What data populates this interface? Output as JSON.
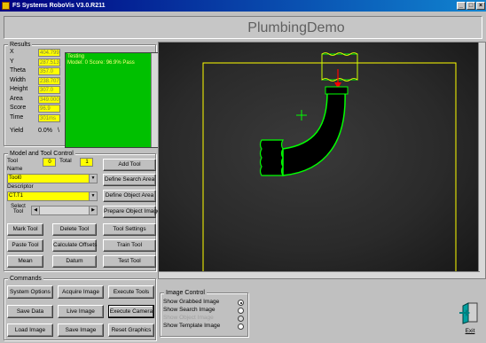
{
  "window": {
    "title": "FS Systems RoboVis V3.0.R211",
    "controls": [
      "_",
      "□",
      "×"
    ]
  },
  "banner": {
    "title": "PlumbingDemo"
  },
  "results": {
    "group_label": "Results",
    "fields": [
      {
        "label": "X",
        "value": "404.799"
      },
      {
        "label": "Y",
        "value": "287.513"
      },
      {
        "label": "Theta",
        "value": "357.0"
      },
      {
        "label": "Width",
        "value": "238.707"
      },
      {
        "label": "Height",
        "value": "307.0"
      },
      {
        "label": "Area",
        "value": "349.000"
      },
      {
        "label": "Score",
        "value": "96.9"
      },
      {
        "label": "Time",
        "value": "301ms"
      }
    ],
    "yield_label": "Yield",
    "yield_value": "0.0%",
    "yield_spinner": "\\",
    "log_lines": [
      "Testing",
      "Model: 0 Score: 96.9% Pass"
    ]
  },
  "model_tool": {
    "group_label": "Model and Tool Control",
    "tool_label": "Tool",
    "tool_value": "0",
    "total_label": "Total",
    "total_value": "1",
    "add_tool": "Add Tool",
    "name_label": "Name",
    "name_value": "Tool0",
    "define_search": "Define Search Area",
    "descriptor_label": "Descriptor",
    "descriptor_value": "CT.T1",
    "define_object": "Define Object Area",
    "select_tool_label": "Select Tool",
    "prepare_image": "Prepare Object Image",
    "mark_tool": "Mark Tool",
    "delete_tool": "Delete Tool",
    "tool_settings": "Tool Settings",
    "paste_tool": "Paste Tool",
    "calculate_offsets": "Calculate Offsets",
    "train_tool": "Train Tool",
    "mean": "Mean",
    "datum": "Datum",
    "test_tool": "Test Tool"
  },
  "commands": {
    "group_label": "Commands",
    "system_options": "System Options",
    "acquire_image": "Acquire Image",
    "execute_tools": "Execute Tools",
    "save_data": "Save Data",
    "live_image": "Live Image",
    "execute_camera": "Execute Camera",
    "load_image": "Load Image",
    "save_image": "Save Image",
    "reset_graphics": "Reset Graphics"
  },
  "image_control": {
    "group_label": "Image Control",
    "options": [
      {
        "label": "Show Grabbed Image",
        "checked": true,
        "enabled": true
      },
      {
        "label": "Show Search Image",
        "checked": false,
        "enabled": true
      },
      {
        "label": "Show Object Image",
        "checked": false,
        "enabled": false
      },
      {
        "label": "Show Template Image",
        "checked": false,
        "enabled": true
      }
    ]
  },
  "exit": {
    "label": "Exit",
    "icon": "exit-door-icon"
  },
  "colors": {
    "accent_title": "#000080",
    "field_yellow": "#ffff00",
    "log_green": "#00c000",
    "overlay_green": "#00ff00",
    "overlay_yellow": "#ffff00",
    "arrow_red": "#ff0000"
  }
}
